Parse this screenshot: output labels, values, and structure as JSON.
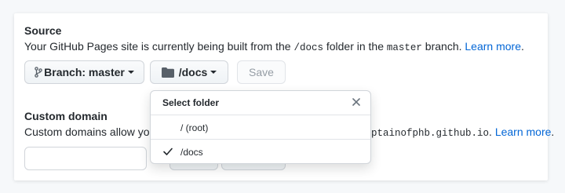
{
  "source": {
    "title": "Source",
    "desc_prefix": "Your GitHub Pages site is currently being built from the ",
    "folder_code": "/docs",
    "desc_mid": " folder in the ",
    "branch_code": "master",
    "desc_suffix": " branch. ",
    "learn_more": "Learn more",
    "period": ".",
    "branch_button": "Branch: master",
    "folder_button": "/docs",
    "save_button": "Save"
  },
  "custom_domain": {
    "title": "Custom domain",
    "desc_prefix": "Custom domains allow you",
    "desc_code_tail": "ptainofphb.github.io",
    "desc_suffix": ". ",
    "learn_more": "Learn more",
    "period": ".",
    "input_value": ""
  },
  "folder_menu": {
    "title": "Select folder",
    "items": [
      {
        "label": "/ (root)",
        "selected": false
      },
      {
        "label": "/docs",
        "selected": true
      }
    ]
  },
  "colors": {
    "link": "#0366d6",
    "text": "#24292e",
    "muted": "#959da5"
  },
  "icons": [
    "git-branch-icon",
    "folder-icon",
    "close-icon",
    "check-icon",
    "chevron-down-icon"
  ]
}
